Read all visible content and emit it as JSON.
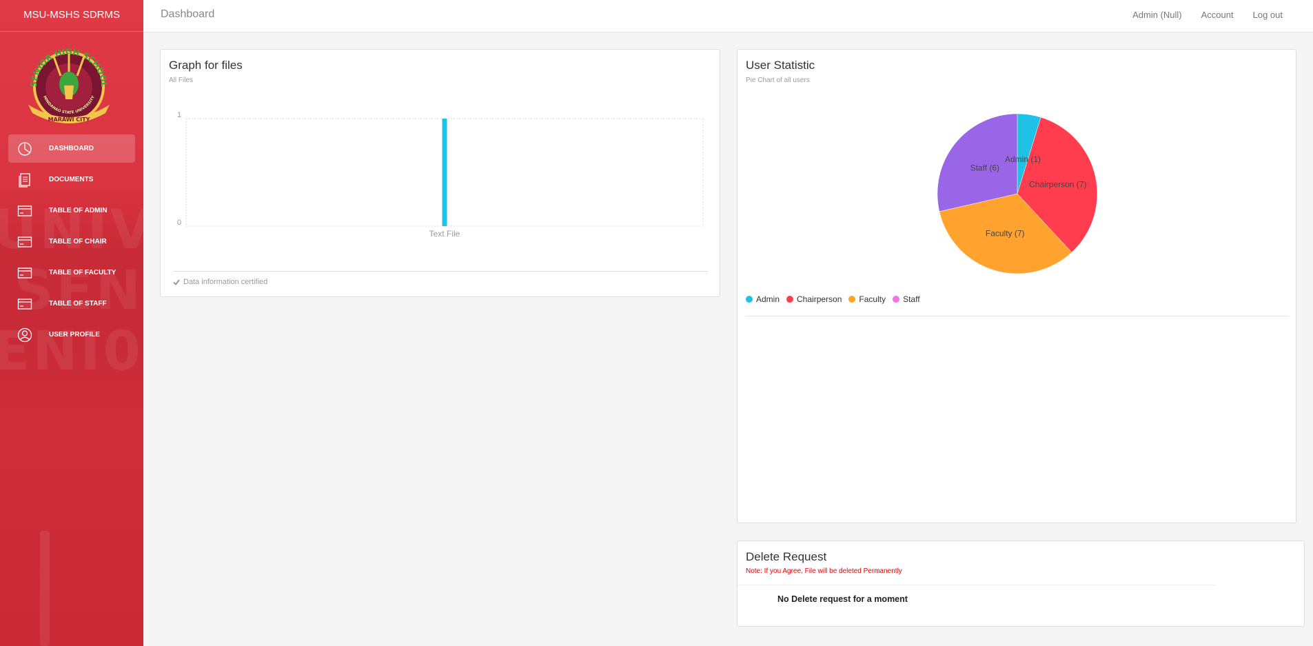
{
  "app": {
    "brand": "MSU-MSHS SDRMS"
  },
  "sidebar": {
    "items": [
      {
        "label": "DASHBOARD",
        "icon": "pie-chart-icon",
        "active": true
      },
      {
        "label": "DOCUMENTS",
        "icon": "document-icon",
        "active": false
      },
      {
        "label": "TABLE OF ADMIN",
        "icon": "card-icon",
        "active": false
      },
      {
        "label": "TABLE OF CHAIR",
        "icon": "card-icon",
        "active": false
      },
      {
        "label": "TABLE OF FACULTY",
        "icon": "card-icon",
        "active": false
      },
      {
        "label": "TABLE OF STAFF",
        "icon": "card-icon",
        "active": false
      },
      {
        "label": "USER PROFILE",
        "icon": "user-icon",
        "active": false
      }
    ]
  },
  "header": {
    "title": "Dashboard",
    "user": "Admin (Null)",
    "account": "Account",
    "logout": "Log out"
  },
  "files_card": {
    "title": "Graph for files",
    "subtitle": "All Files",
    "footer": "Data information certified"
  },
  "user_card": {
    "title": "User Statistic",
    "subtitle": "Pie Chart of all users"
  },
  "delete_card": {
    "title": "Delete Request",
    "note": "Note: If you Agree, File will be deleted Permanently",
    "empty_message": "No Delete request for a moment"
  },
  "colors": {
    "sidebar": "#d8323e",
    "admin": "#1fc1e6",
    "chairperson": "#ff3d4e",
    "faculty": "#ffa22e",
    "staff": "#9966e8",
    "staff_legend": "#ee77dd"
  },
  "chart_data": [
    {
      "type": "bar",
      "categories": [
        "Text File"
      ],
      "values": [
        1
      ],
      "ylim": [
        0,
        1
      ],
      "yticks": [
        0,
        1
      ],
      "grid": true
    },
    {
      "type": "pie",
      "labels": [
        "Admin",
        "Chairperson",
        "Faculty",
        "Staff"
      ],
      "values": [
        1,
        7,
        7,
        6
      ],
      "slice_labels": [
        "Admin (1)",
        "Chairperson (7)",
        "Faculty (7)",
        "Staff (6)"
      ],
      "legend": "bottom-left",
      "legend_colors": [
        "#1fc1e6",
        "#ff3d4e",
        "#ffa22e",
        "#ee77dd"
      ]
    }
  ]
}
